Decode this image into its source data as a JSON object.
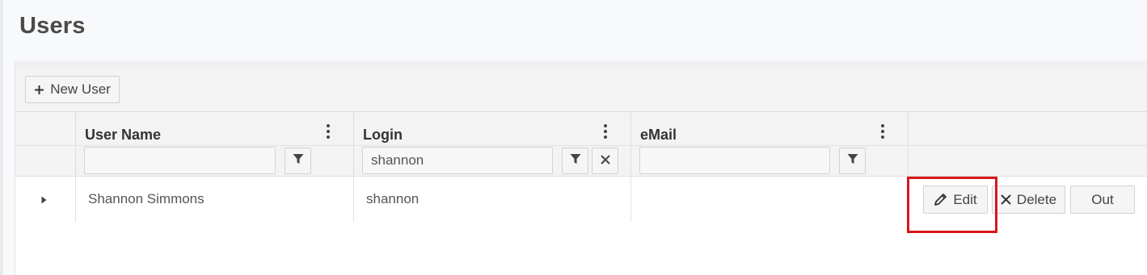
{
  "page": {
    "title": "Users"
  },
  "toolbar": {
    "new_user_label": "New User",
    "new_user_icon": "plus-icon"
  },
  "columns": [
    {
      "title": "User Name",
      "filter_value": "",
      "filter_icon": "filter-icon"
    },
    {
      "title": "Login",
      "filter_value": "shannon",
      "filter_icon": "filter-icon",
      "clear_icon": "close-icon"
    },
    {
      "title": "eMail",
      "filter_value": "",
      "filter_icon": "filter-icon"
    }
  ],
  "rows": [
    {
      "user_name": "Shannon Simmons",
      "login": "shannon",
      "email": "",
      "actions": {
        "edit_label": "Edit",
        "delete_label": "Delete",
        "out_label": "Out"
      }
    }
  ],
  "highlight": {
    "target": "Edit",
    "color": "#d9161c"
  }
}
